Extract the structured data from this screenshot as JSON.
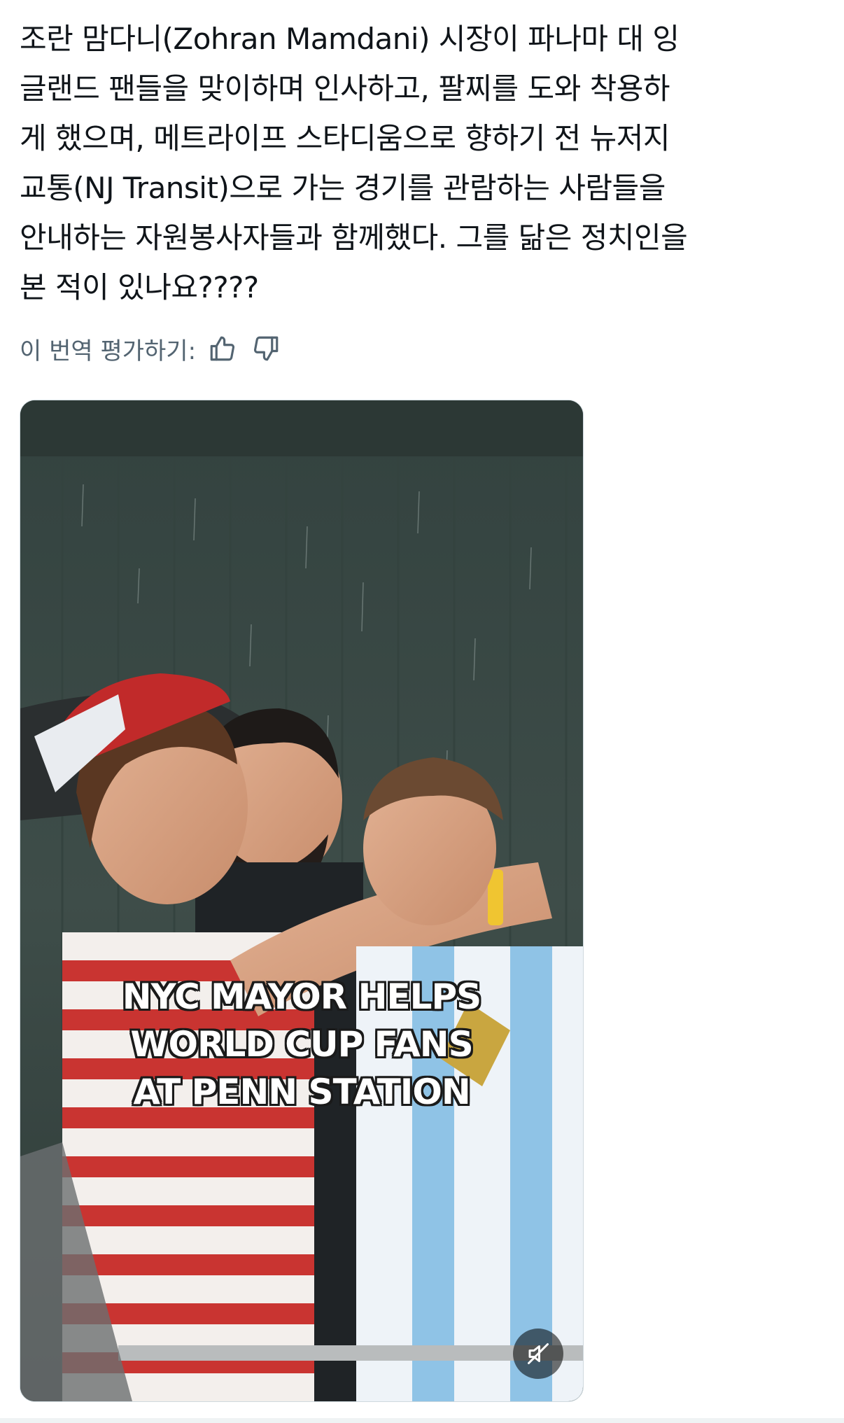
{
  "post": {
    "text": "조란 맘다니(Zohran Mamdani) 시장이 파나마 대 잉\n글랜드 팬들을 맞이하며 인사하고, 팔찌를 도와 착용하\n게 했으며, 메트라이프 스타디움으로 향하기 전 뉴저지\n교통(NJ Transit)으로 가는 경기를 관람하는 사람들을\n안내하는 자원봉사자들과 함께했다. 그를 닮은 정치인을\n본 적이 있나요????"
  },
  "translation_rating": {
    "label": "이 번역 평가하기:",
    "thumbs_up_icon": "thumbs-up-icon",
    "thumbs_down_icon": "thumbs-down-icon"
  },
  "media": {
    "type": "video",
    "caption_lines": [
      "NYC MAYOR HELPS",
      "WORLD CUP FANS",
      "AT PENN STATION"
    ],
    "mute_icon": "speaker-muted-icon",
    "colors": {
      "wall": "#3d4c48",
      "caption_text": "#ffffff",
      "caption_outline": "#1a1a1a"
    }
  }
}
